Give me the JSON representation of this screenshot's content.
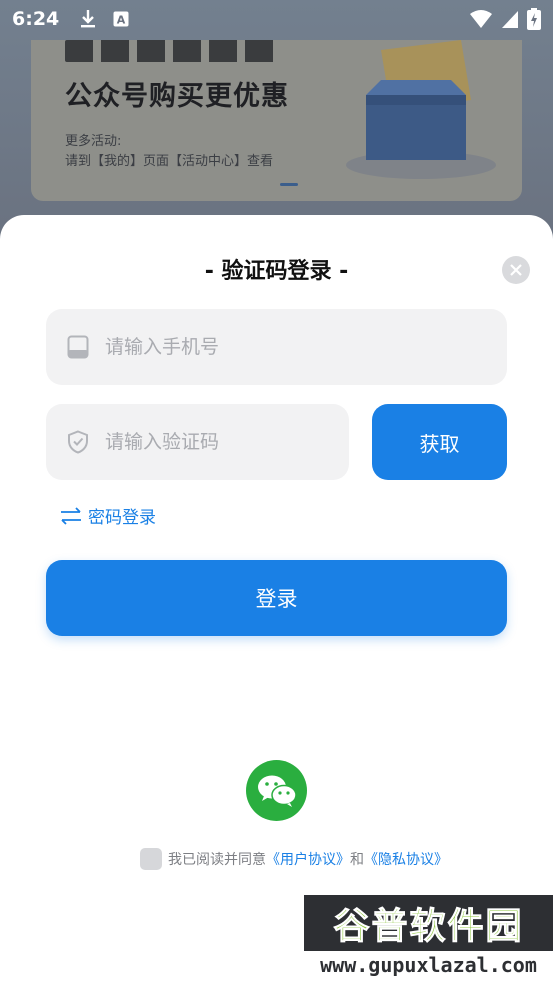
{
  "status_bar": {
    "time": "6:24",
    "left_icons": [
      "download-icon",
      "font-app-icon"
    ],
    "right_icons": [
      "wifi-icon",
      "signal-icon",
      "battery-icon"
    ]
  },
  "banner": {
    "title": "公众号购买更优惠",
    "sub_line1": "更多活动:",
    "sub_line2": "请到【我的】页面【活动中心】查看"
  },
  "login_sheet": {
    "title": "- 验证码登录 -",
    "phone_placeholder": "请输入手机号",
    "code_placeholder": "请输入验证码",
    "get_code_label": "获取",
    "switch_login_label": "密码登录",
    "login_label": "登录",
    "agreement_prefix": "我已阅读并同意",
    "user_agreement": "《用户协议》",
    "agreement_and": "和",
    "privacy_policy": "《隐私协议》"
  },
  "watermark": {
    "title": "谷普软件园",
    "url": "www.gupuxlazal.com"
  },
  "colors": {
    "accent": "#1a80e5",
    "wechat": "#2aae3f",
    "field_bg": "#f2f2f3"
  }
}
